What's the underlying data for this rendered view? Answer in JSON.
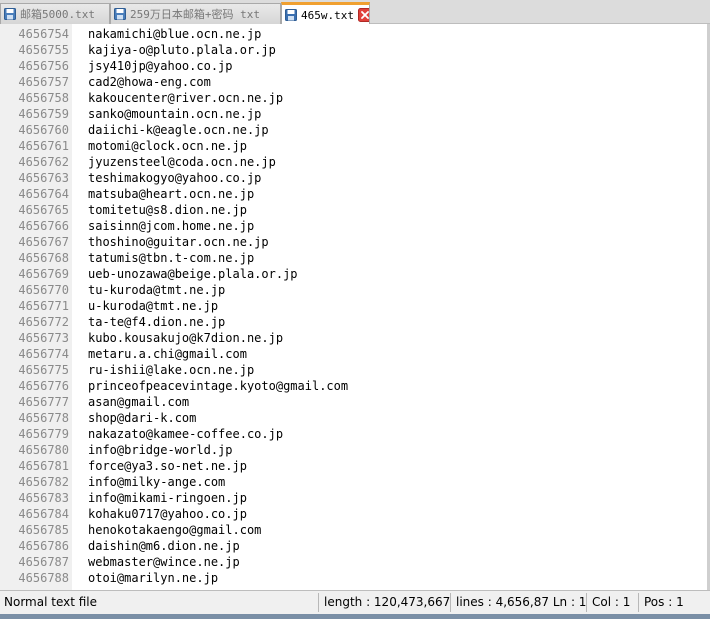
{
  "tabs": [
    {
      "label": "邮箱5000.txt",
      "icon": "save-disk-icon",
      "active": false
    },
    {
      "label": "259万日本邮箱+密码 txt",
      "icon": "save-disk-icon",
      "active": false
    },
    {
      "label": "465w.txt",
      "icon": "save-disk-icon",
      "active": true
    }
  ],
  "editor": {
    "lines": [
      {
        "num": "4656754",
        "text": "nakamichi@blue.ocn.ne.jp"
      },
      {
        "num": "4656755",
        "text": "kajiya-o@pluto.plala.or.jp"
      },
      {
        "num": "4656756",
        "text": "jsy410jp@yahoo.co.jp"
      },
      {
        "num": "4656757",
        "text": "cad2@howa-eng.com"
      },
      {
        "num": "4656758",
        "text": "kakoucenter@river.ocn.ne.jp"
      },
      {
        "num": "4656759",
        "text": "sanko@mountain.ocn.ne.jp"
      },
      {
        "num": "4656760",
        "text": "daiichi-k@eagle.ocn.ne.jp"
      },
      {
        "num": "4656761",
        "text": "motomi@clock.ocn.ne.jp"
      },
      {
        "num": "4656762",
        "text": "jyuzensteel@coda.ocn.ne.jp"
      },
      {
        "num": "4656763",
        "text": "teshimakogyo@yahoo.co.jp"
      },
      {
        "num": "4656764",
        "text": "matsuba@heart.ocn.ne.jp"
      },
      {
        "num": "4656765",
        "text": "tomitetu@s8.dion.ne.jp"
      },
      {
        "num": "4656766",
        "text": "saisinn@jcom.home.ne.jp"
      },
      {
        "num": "4656767",
        "text": "thoshino@guitar.ocn.ne.jp"
      },
      {
        "num": "4656768",
        "text": "tatumis@tbn.t-com.ne.jp"
      },
      {
        "num": "4656769",
        "text": "ueb-unozawa@beige.plala.or.jp"
      },
      {
        "num": "4656770",
        "text": "tu-kuroda@tmt.ne.jp"
      },
      {
        "num": "4656771",
        "text": "u-kuroda@tmt.ne.jp"
      },
      {
        "num": "4656772",
        "text": "ta-te@f4.dion.ne.jp"
      },
      {
        "num": "4656773",
        "text": "kubo.kousakujo@k7dion.ne.jp"
      },
      {
        "num": "4656774",
        "text": "metaru.a.chi@gmail.com"
      },
      {
        "num": "4656775",
        "text": "ru-ishii@lake.ocn.ne.jp"
      },
      {
        "num": "4656776",
        "text": "princeofpeacevintage.kyoto@gmail.com"
      },
      {
        "num": "4656777",
        "text": "asan@gmail.com"
      },
      {
        "num": "4656778",
        "text": "shop@dari-k.com"
      },
      {
        "num": "4656779",
        "text": "nakazato@kamee-coffee.co.jp"
      },
      {
        "num": "4656780",
        "text": "info@bridge-world.jp"
      },
      {
        "num": "4656781",
        "text": "force@ya3.so-net.ne.jp"
      },
      {
        "num": "4656782",
        "text": "info@milky-ange.com"
      },
      {
        "num": "4656783",
        "text": "info@mikami-ringoen.jp"
      },
      {
        "num": "4656784",
        "text": "kohaku0717@yahoo.co.jp"
      },
      {
        "num": "4656785",
        "text": "henokotakaengo@gmail.com"
      },
      {
        "num": "4656786",
        "text": "daishin@m6.dion.ne.jp"
      },
      {
        "num": "4656787",
        "text": "webmaster@wince.ne.jp"
      },
      {
        "num": "4656788",
        "text": "otoi@marilyn.ne.jp"
      }
    ]
  },
  "status": {
    "file_type": "Normal text file",
    "length": "length : 120,473,667",
    "lines_ln": "lines : 4,656,87 Ln : 1",
    "col": "Col : 1",
    "pos": "Pos : 1"
  },
  "colors": {
    "active_tab_accent": "#f0a030",
    "inactive_icon": "#4a7ebb",
    "active_icon": "#3a6fb0",
    "close_red": "#e0403a"
  }
}
